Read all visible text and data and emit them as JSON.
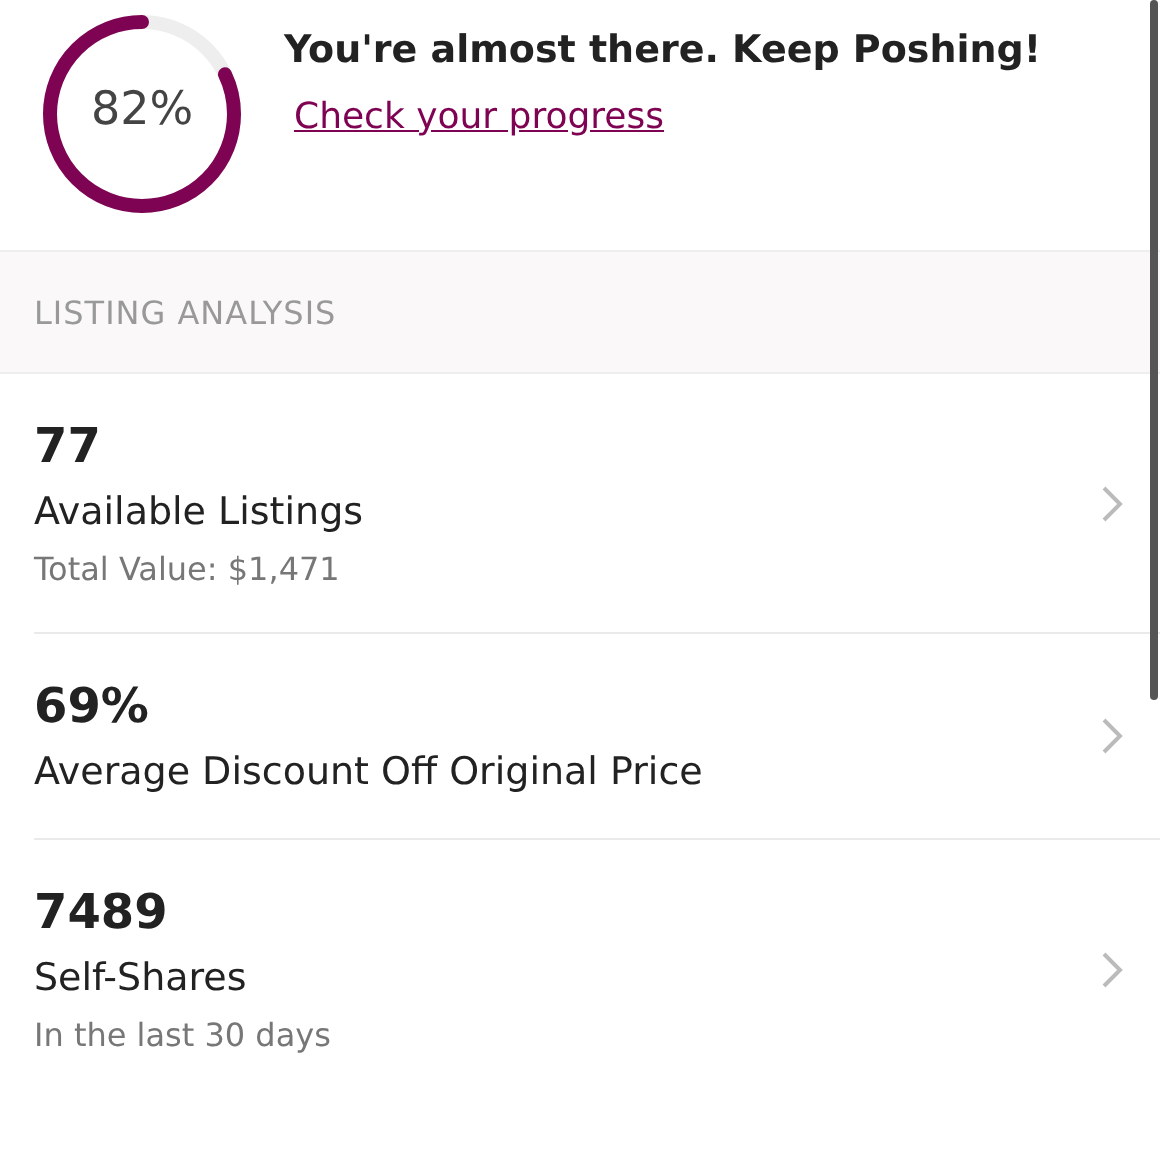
{
  "progress": {
    "level": 0.82,
    "reading": "82%",
    "message": "You're almost there. Keep Poshing!",
    "link": "Check your progress"
  },
  "section": {
    "title": "LISTING ANALYSIS"
  },
  "stats": [
    {
      "value": "77",
      "label": "Available Listings",
      "note": "Total Value: $1,471"
    },
    {
      "value": "69%",
      "label": "Average Discount Off Original Price"
    },
    {
      "value": "7489",
      "label": "Self-Shares",
      "note": "In the last 30 days"
    }
  ]
}
